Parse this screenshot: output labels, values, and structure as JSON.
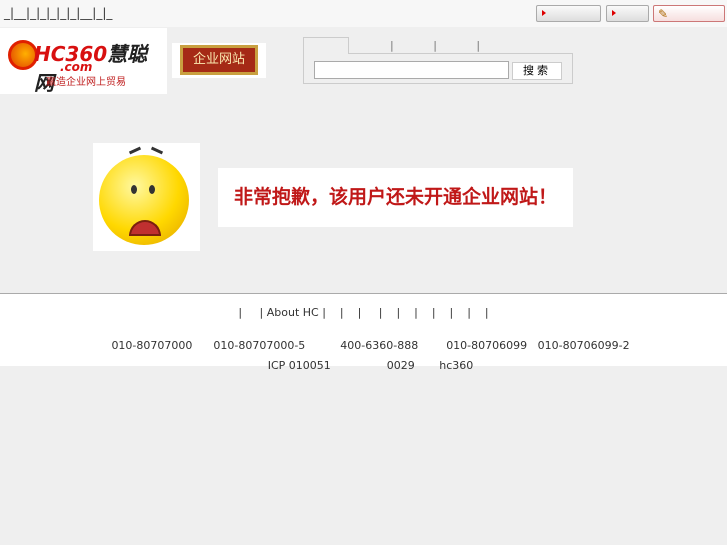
{
  "topbar": {
    "links": "_|__|_|_|_|_|_|__|_|_"
  },
  "logo": {
    "name": "HC360",
    "brand": "慧聪网",
    "domain": ".com",
    "slogan": "赢造企业网上贸易"
  },
  "sign": {
    "text": "企业网站"
  },
  "search": {
    "value": "",
    "button": "搜索",
    "tab_separators": "| | |"
  },
  "message": {
    "text": "非常抱歉，该用户还未开通企业网站！"
  },
  "footer": {
    "links": "|     | About HC |    |    |     |    |    |    |    |    |    |",
    "phones": [
      "010-80707000",
      "010-80707000-5",
      "400-6360-888",
      "010-80706099",
      "010-80706099-2"
    ],
    "icp": "ICP 010051",
    "num": "0029",
    "site": "hc360"
  }
}
